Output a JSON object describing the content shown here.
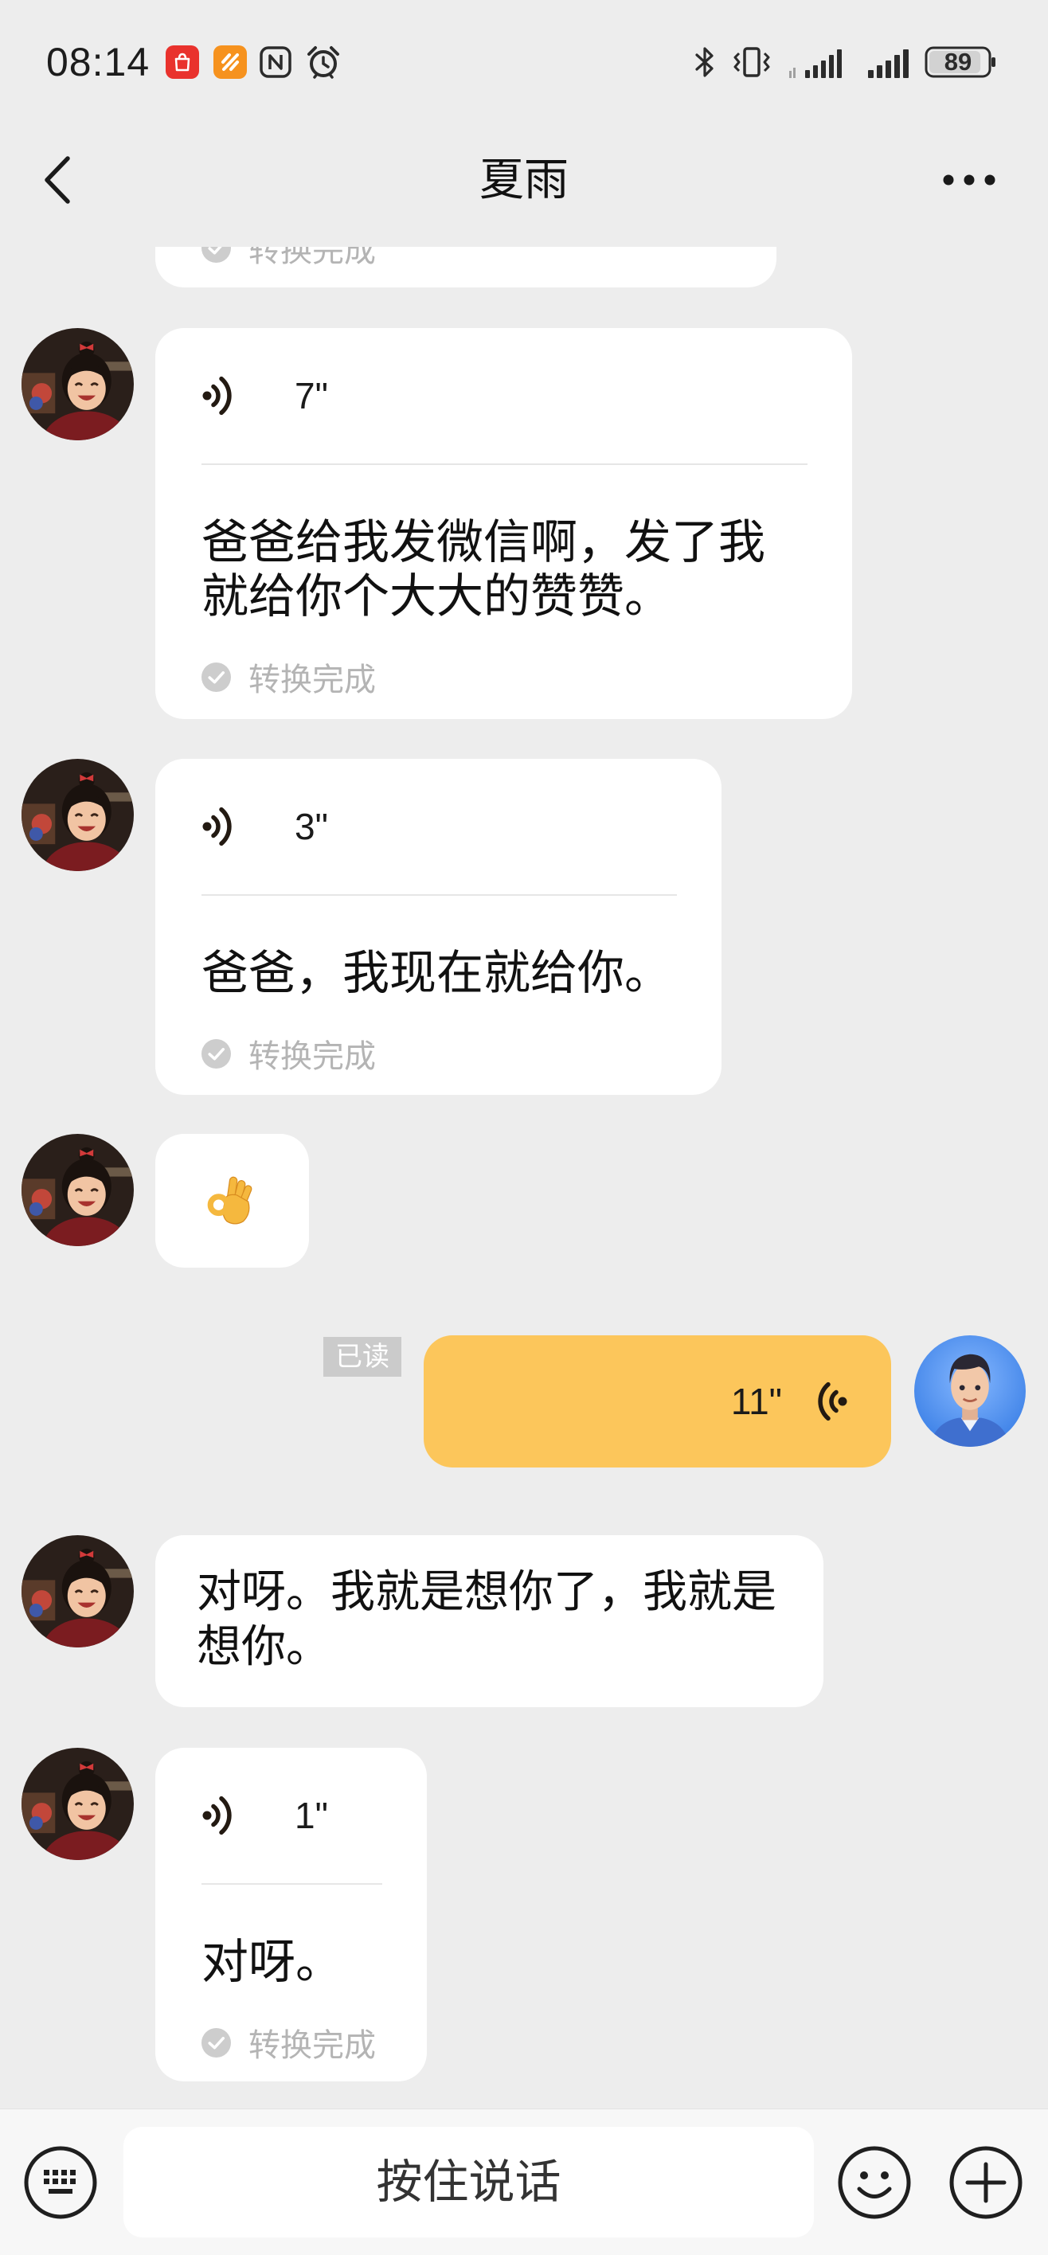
{
  "status_bar": {
    "time": "08:14",
    "battery_percent": "89",
    "battery_level": 0.89,
    "left_icons": [
      "huawei-appgallery-icon",
      "orange-app-icon",
      "nfc-icon",
      "alarm-icon"
    ],
    "right_icons": [
      "bluetooth-icon",
      "vibrate-icon",
      "signal-icon",
      "signal-icon",
      "battery-icon"
    ]
  },
  "header": {
    "back_icon": "chevron-left-icon",
    "title": "夏雨",
    "more_icon": "more-dots-icon"
  },
  "messages": [
    {
      "incoming": true,
      "status": "转换完成"
    },
    {
      "incoming": true,
      "duration": "7\"",
      "transcript_lines": [
        "爸爸给我发微信啊，发了我",
        "就给你个大大的赞赞。"
      ],
      "status": "转换完成"
    },
    {
      "incoming": true,
      "duration": "3\"",
      "transcript_lines": [
        "爸爸，我现在就给你。"
      ],
      "status": "转换完成"
    },
    {
      "incoming": true,
      "emoji_icon": "ok-hand-icon"
    },
    {
      "incoming": false,
      "duration": "11\"",
      "read_badge": "已读"
    },
    {
      "incoming": true,
      "lines": [
        "对呀。我就是想你了，我就是",
        "想你。"
      ]
    },
    {
      "incoming": true,
      "duration": "1\"",
      "transcript_lines": [
        "对呀。"
      ],
      "status": "转换完成"
    }
  ],
  "composer": {
    "keyboard_icon": "keyboard-icon",
    "hold_to_talk_label": "按住说话",
    "emoji_icon": "smiley-icon",
    "more_icon": "plus-circle-icon"
  },
  "colors": {
    "background": "#ededed",
    "bubble_received": "#ffffff",
    "bubble_sent": "#fcc65b",
    "composer_bar": "#f7f7f7",
    "muted_text": "#b4b4b4"
  }
}
